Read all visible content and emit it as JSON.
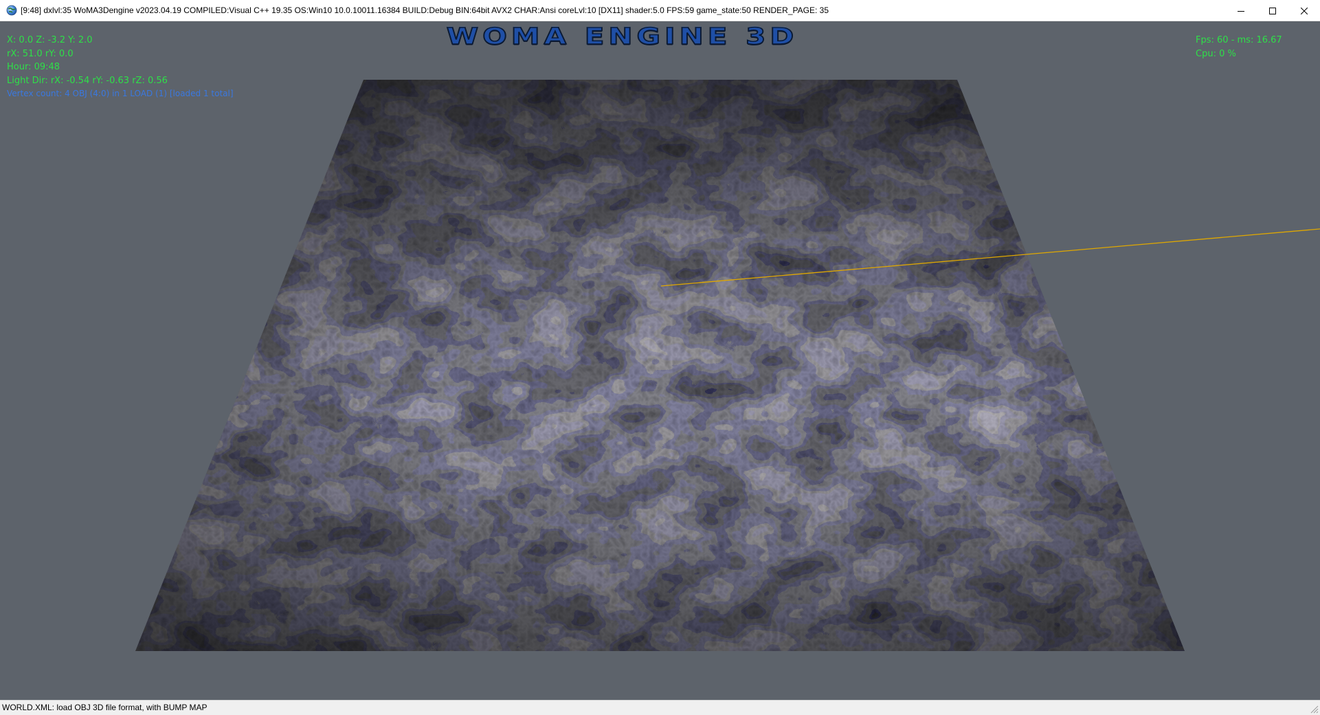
{
  "window": {
    "title": "[9:48] dxlvl:35 WoMA3Dengine v2023.04.19 COMPILED:Visual C++ 19.35 OS:Win10 10.0.10011.16384 BUILD:Debug BIN:64bit AVX2 CHAR:Ansi coreLvl:10 [DX11] shader:5.0 FPS:59 game_state:50 RENDER_PAGE: 35",
    "icon": "globe-icon",
    "controls": [
      "minimize-icon",
      "maximize-icon",
      "close-icon"
    ]
  },
  "viewport": {
    "background_color": "#5d636b",
    "logo_text": "WOMA ENGINE 3D",
    "hud_left": {
      "position": "X: 0.0 Z: -3.2 Y: 2.0",
      "rotation": "rX: 51.0 rY: 0.0",
      "hour": "Hour: 09:48",
      "light_dir": "Light Dir: rX: -0.54 rY: -0.63 rZ: 0.56",
      "render_info": "Vertex count: 4 OBJ (4:0) in 1 LOAD (1) [loaded 1 total]"
    },
    "hud_right": {
      "fps": "Fps: 60 - ms: 16.67",
      "cpu": "Cpu: 0 %"
    },
    "hud_color": "#2ee048",
    "hud_info_color": "#3a78e0",
    "ray_color": "#e0a800",
    "floor_texture": "rocky-gravel-texture"
  },
  "status_bar": {
    "text": "WORLD.XML: load OBJ 3D file format, with BUMP MAP"
  }
}
